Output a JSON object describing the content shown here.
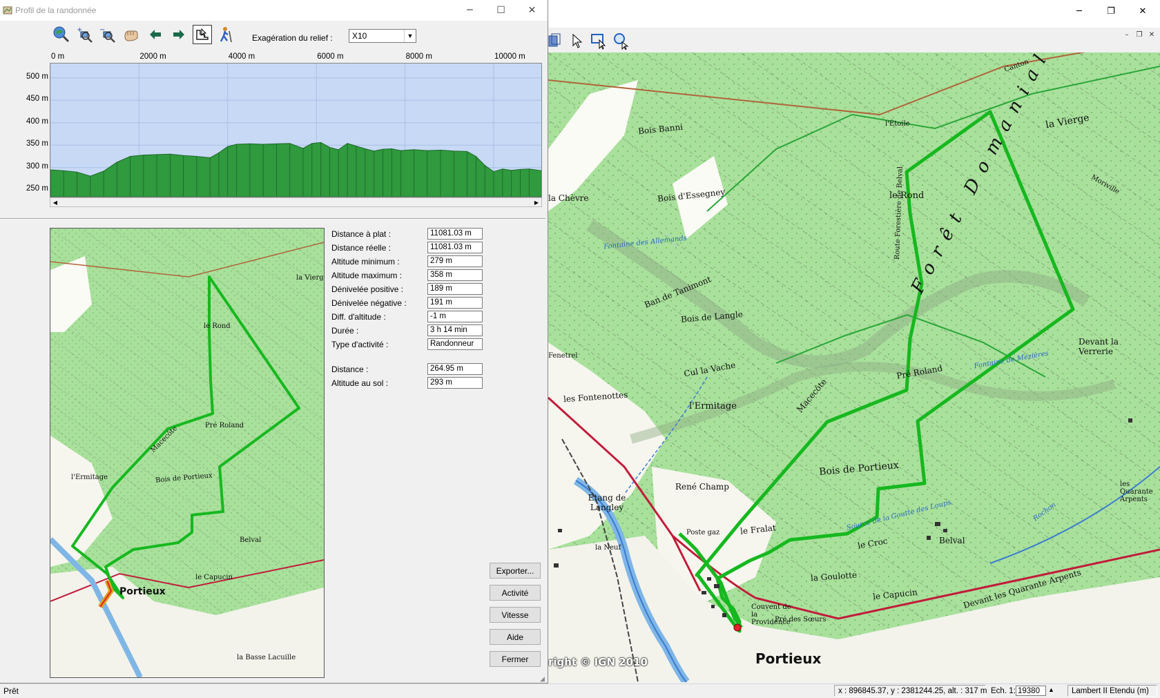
{
  "main_window": {
    "controls": {
      "minimize": "─",
      "restore": "❐",
      "close": "✕"
    },
    "mdi_controls": {
      "minimize": "–",
      "restore": "❐",
      "close": "✕"
    },
    "toolbar_tools": [
      "pointer-tool",
      "zoom-rectangle-tool",
      "zoom-tool"
    ]
  },
  "map": {
    "copyright": "right © IGN 2010",
    "labels": {
      "portieux": "Portieux",
      "bois_de_portieux": "Bois de Portieux",
      "foret": "Forêt Domaniale de",
      "la_vierge": "la Vierge",
      "bois_banni": "Bois Banni",
      "bois_dessegney": "Bois d'Essegney",
      "la_chevre": "la Chèvre",
      "le_rond": "le Rond",
      "route_forestiere_de_belval": "Route Forestière de Belval",
      "bois_de_langle": "Bois de Langle",
      "ban_de_tanimont": "Ban de Tanimont",
      "cul_la_vache": "Cul la Vache",
      "l_ermitage": "l'Ermitage",
      "les_fontenottes": "les Fontenottes",
      "pre_roland": "Pré Roland",
      "macecote": "Macecôte",
      "etang_de_langley": "Etang de Langley",
      "rene_champ": "René Champ",
      "poste_gaz": "Poste gaz",
      "le_fralat": "le Fralat",
      "le_croc": "le Croc",
      "la_goulotte": "la Goulotte",
      "le_capucin": "le Capucin",
      "belval": "Belval",
      "devant_les_quarante_arpents": "Devant les Quarante Arpents",
      "pre_des_soeurs": "Pré des Sœurs",
      "devant_la_verrerie": "Devant la Verrerie",
      "source_de_la_goutte": "Source de la Goutte des Loups",
      "fontaine_des_allemands": "Fontaine des Allemands",
      "fontaine_de_mezieres": "Fontaine de Mézières",
      "couvent": "Couvent de la Providence",
      "canton": "Canton",
      "moriville": "Moriville",
      "l_etoile": "l'Étoile",
      "fenetrel": "Fenetrel",
      "la_neuf": "la Neuf",
      "rochon": "Rochon",
      "les_quarante_arpents": "les Quarante Arpents"
    }
  },
  "statusbar": {
    "ready": "Prêt",
    "coords": "x : 896845.37, y : 2381244.25, alt. : 317 m",
    "scale_label": "Ech. 1:",
    "scale_value": "19380",
    "projection": "Lambert II Etendu (m)"
  },
  "dialog": {
    "title": "Profil de la randonnée",
    "controls": {
      "minimize": "─",
      "maximize": "☐",
      "close": "✕"
    },
    "toolbar": [
      "zoom-extent-icon",
      "zoom-in-icon",
      "zoom-out-icon",
      "pan-hand-icon",
      "arrow-left-icon",
      "arrow-right-icon",
      "profile-cursor-icon",
      "hiker-icon"
    ],
    "exaggeration_label": "Exagération du relief :",
    "exaggeration_value": "X10",
    "chart_data": {
      "type": "area",
      "xlabel": "",
      "ylabel": "",
      "x_ticks": [
        "0 m",
        "2000 m",
        "4000 m",
        "6000 m",
        "8000 m",
        "10000 m"
      ],
      "y_ticks": [
        "500 m",
        "450 m",
        "400 m",
        "350 m",
        "300 m",
        "250 m"
      ],
      "xlim": [
        0,
        11081
      ],
      "ylim": [
        235,
        532
      ],
      "x": [
        0,
        300,
        600,
        900,
        1200,
        1500,
        1800,
        2100,
        2400,
        2700,
        3000,
        3300,
        3600,
        3800,
        4000,
        4200,
        4500,
        4800,
        5100,
        5400,
        5700,
        5900,
        6100,
        6300,
        6500,
        6700,
        6900,
        7100,
        7300,
        7500,
        7700,
        7900,
        8200,
        8500,
        8800,
        9100,
        9400,
        9600,
        9800,
        10000,
        10200,
        10400,
        10600,
        10800,
        11081
      ],
      "y": [
        295,
        293,
        290,
        281,
        292,
        312,
        325,
        328,
        329,
        330,
        327,
        325,
        322,
        333,
        347,
        352,
        353,
        352,
        353,
        354,
        343,
        354,
        356,
        345,
        340,
        354,
        348,
        342,
        337,
        341,
        342,
        338,
        340,
        338,
        339,
        337,
        336,
        325,
        305,
        291,
        297,
        294,
        296,
        297,
        293
      ],
      "series": [
        {
          "values": [
            295,
            293,
            290,
            281,
            292,
            312,
            325,
            328,
            329,
            330,
            327,
            325,
            322,
            333,
            347,
            352,
            353,
            352,
            353,
            354,
            343,
            354,
            356,
            345,
            340,
            354,
            348,
            342,
            337,
            341,
            342,
            338,
            340,
            338,
            339,
            337,
            336,
            325,
            305,
            291,
            297,
            294,
            296,
            297,
            293
          ]
        }
      ],
      "grid": true,
      "colors": {
        "fill": "#2f9a3e",
        "background": "#c7d9f5",
        "grid": "#a9bfe6"
      }
    },
    "stats": [
      {
        "label": "Distance à plat :",
        "value": "11081.03 m"
      },
      {
        "label": "Distance réelle :",
        "value": "11081.03 m"
      },
      {
        "label": "Altitude minimum :",
        "value": "279 m"
      },
      {
        "label": "Altitude maximum :",
        "value": "358 m"
      },
      {
        "label": "Dénivelée positive :",
        "value": "189 m"
      },
      {
        "label": "Dénivelée négative :",
        "value": "191 m"
      },
      {
        "label": "Diff. d'altitude :",
        "value": "-1 m"
      },
      {
        "label": "Durée :",
        "value": "3 h 14 min"
      },
      {
        "label": "Type d'activité :",
        "value": "Randonneur"
      }
    ],
    "cursor_stats": [
      {
        "label": "Distance :",
        "value": "264.95 m"
      },
      {
        "label": "Altitude au sol :",
        "value": "293 m"
      }
    ],
    "buttons": {
      "export": "Exporter...",
      "activity": "Activité",
      "speed": "Vitesse",
      "help": "Aide",
      "close": "Fermer"
    },
    "minimap_labels": {
      "portieux": "Portieux",
      "bois_de_portieux": "Bois de Portieux",
      "le_rond": "le Rond",
      "pre_roland": "Pré Roland",
      "belval": "Belval",
      "la_vierge": "la Vierge",
      "l_ermitage": "l'Ermitage",
      "macecote": "Macecôte",
      "le_capucin": "le Capucin",
      "la_basse_lacuille": "la Basse Lacuille"
    }
  }
}
